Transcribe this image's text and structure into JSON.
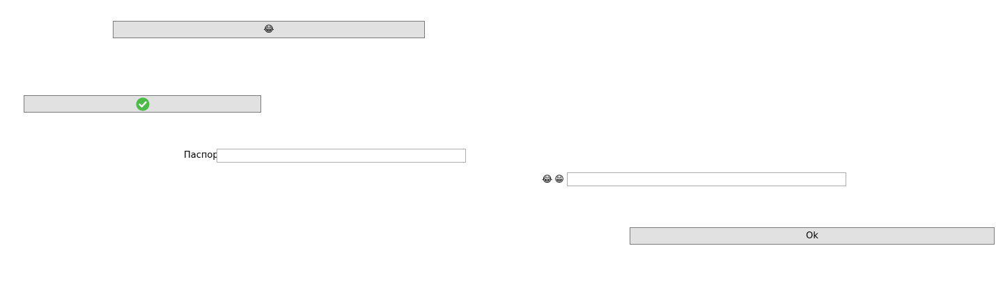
{
  "button_top": {
    "icon": "😂"
  },
  "button_check": {
    "icon_name": "check-circle-icon",
    "color": "#4cbb47"
  },
  "passport": {
    "label": "Паспорт",
    "value": ""
  },
  "emoji_field": {
    "icon1": "😂",
    "icon2": "😁",
    "value": ""
  },
  "ok_button": {
    "label": "Ok"
  }
}
